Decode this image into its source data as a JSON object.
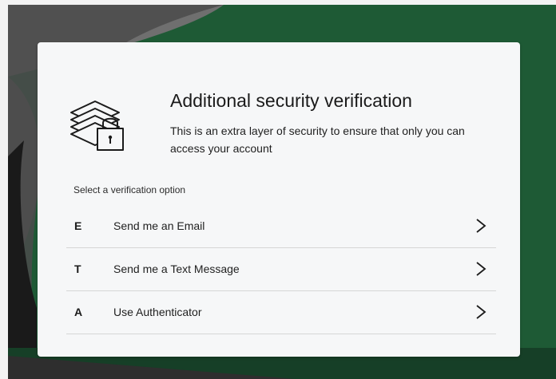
{
  "dialog": {
    "title": "Additional security verification",
    "subtitle": "This is an extra layer of security to ensure that only you can access your account",
    "header_icon": "layers-lock-icon"
  },
  "verification": {
    "section_label": "Select a verification option",
    "options": [
      {
        "key": "E",
        "label": "Send me an Email",
        "icon": "chevron-right-icon"
      },
      {
        "key": "T",
        "label": "Send me a Text Message",
        "icon": "chevron-right-icon"
      },
      {
        "key": "A",
        "label": "Use Authenticator",
        "icon": "chevron-right-icon"
      }
    ]
  },
  "colors": {
    "background_green": "#1e5a35",
    "background_dark": "#163f27",
    "card": "#f6f7f8",
    "divider": "#d6d6d6",
    "text": "#1b1b1b"
  }
}
